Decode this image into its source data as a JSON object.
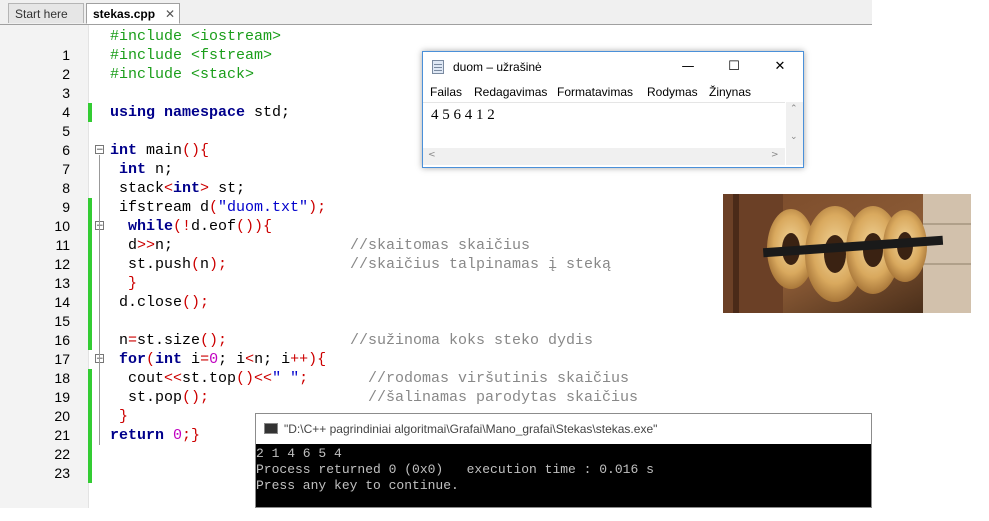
{
  "tabs": [
    {
      "label": "Start here",
      "active": false
    },
    {
      "label": "stekas.cpp",
      "active": true,
      "close_glyph": "✕"
    }
  ],
  "code_lines": [
    {
      "n": "1"
    },
    {
      "n": "2"
    },
    {
      "n": "3"
    },
    {
      "n": "4"
    },
    {
      "n": "5"
    },
    {
      "n": "6"
    },
    {
      "n": "7"
    },
    {
      "n": "8"
    },
    {
      "n": "9"
    },
    {
      "n": "10"
    },
    {
      "n": "11"
    },
    {
      "n": "12"
    },
    {
      "n": "13"
    },
    {
      "n": "14"
    },
    {
      "n": "15"
    },
    {
      "n": "16"
    },
    {
      "n": "17"
    },
    {
      "n": "18"
    },
    {
      "n": "19"
    },
    {
      "n": "20"
    },
    {
      "n": "21"
    },
    {
      "n": "22"
    },
    {
      "n": "23"
    }
  ],
  "code": {
    "l1": {
      "a": "#include <iostream>"
    },
    "l2": {
      "a": "#include <fstream>"
    },
    "l3": {
      "a": "#include <stack>"
    },
    "l5": {
      "kw": "using namespace",
      "rest": " std;"
    },
    "l7": {
      "kw": "int",
      "rest": " main",
      "p": "(){"
    },
    "l8": {
      "kw": " int",
      "rest": " n;"
    },
    "l9": {
      "a": " stack",
      "b": "<",
      "kw": "int",
      "c": ">",
      "d": " st;"
    },
    "l10": {
      "a": " ifstream d",
      "b": "(",
      "str": "\"duom.txt\"",
      "c": ");"
    },
    "l11": {
      "kw": "  while",
      "b": "(!",
      "a": "d.eof",
      "c": "()){"
    },
    "l12": {
      "a": "  d",
      "b": ">>",
      "c": "n;",
      "cm": "//skaitomas skaičius"
    },
    "l13": {
      "a": "  st.push",
      "b": "(",
      "c": "n",
      "d": ");",
      "cm": "//skaičius talpinamas į steką"
    },
    "l14": {
      "b": "  }"
    },
    "l15": {
      "a": " d.close",
      "b": "();"
    },
    "l17": {
      "a": " n",
      "b": "=",
      "c": "st.size",
      "d": "();",
      "cm": "//sužinoma koks steko dydis"
    },
    "l18": {
      "kw": " for",
      "b": "(",
      "kw2": "int",
      "c": " i",
      "d": "=",
      "num": "0",
      "e": "; i",
      "f": "<",
      "g": "n; i",
      "h": "++){"
    },
    "l19": {
      "a": "  cout",
      "b": "<<",
      "c": "st.top",
      "d": "()<<",
      "str": "\" \"",
      "e": ";",
      "cm": "//rodomas viršutinis skaičius"
    },
    "l20": {
      "a": "  st.pop",
      "b": "();",
      "cm": "//šalinamas parodytas skaičius"
    },
    "l21": {
      "b": " }"
    },
    "l22": {
      "kw": "return",
      "sp": " ",
      "num": "0",
      "b": ";}"
    }
  },
  "notepad": {
    "title": "duom – užrašinė",
    "menu": [
      "Failas",
      "Redagavimas",
      "Formatavimas",
      "Rodymas",
      "Žinynas"
    ],
    "content": "4 5 6 4 1 2",
    "buttons": {
      "minimize": "—",
      "maximize": "☐",
      "close": "✕"
    }
  },
  "console": {
    "title": "\"D:\\C++ pagrindiniai algoritmai\\Grafai\\Mano_grafai\\Stekas\\stekas.exe\"",
    "lines": [
      "2 1 4 6 5 4",
      "Process returned 0 (0x0)   execution time : 0.016 s",
      "Press any key to continue."
    ]
  },
  "colors": {
    "preprocessor": "#1a9e1a",
    "keyword": "#00008b",
    "string": "#0000cc",
    "number": "#c000c0",
    "operator": "#cc0000",
    "comment": "#888888",
    "changebar": "#33cc33"
  },
  "photo": {
    "icon": "bagels-on-stick-photo"
  }
}
